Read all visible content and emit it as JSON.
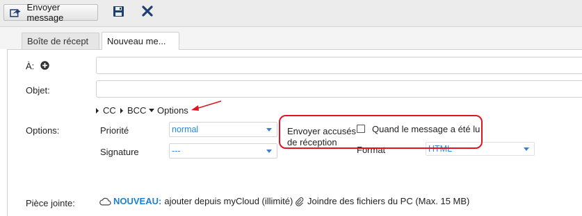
{
  "toolbar": {
    "send_label": "Envoyer message",
    "save_icon": "save-icon",
    "close_icon": "close-icon"
  },
  "tabs": [
    {
      "label": "Boîte de récept",
      "active": false
    },
    {
      "label": "Nouveau me...",
      "active": true
    }
  ],
  "form": {
    "to_label": "À:",
    "to_value": "",
    "subject_label": "Objet:",
    "subject_value": "",
    "toggles": {
      "cc": "CC",
      "bcc": "BCC",
      "options": "Options"
    },
    "options_label": "Options:",
    "priority_label": "Priorité",
    "priority_value": "normal",
    "signature_label": "Signature",
    "signature_value": "---",
    "receipt_label_line1": "Envoyer accusés",
    "receipt_label_line2": "de réception",
    "receipt_checkbox_label": "Quand le message a été lu",
    "receipt_checked": false,
    "format_label": "Format",
    "format_value": "HTML",
    "attachment_label": "Pièce jointe:",
    "attach_new": "NOUVEAU:",
    "attach_cloud": "ajouter depuis myCloud (illimité)",
    "attach_pc": "Joindre des fichiers du PC (Max. 15 MB)"
  },
  "colors": {
    "accent": "#1a7fd8",
    "highlight": "#e0141e",
    "select_text": "#2f86d6"
  }
}
